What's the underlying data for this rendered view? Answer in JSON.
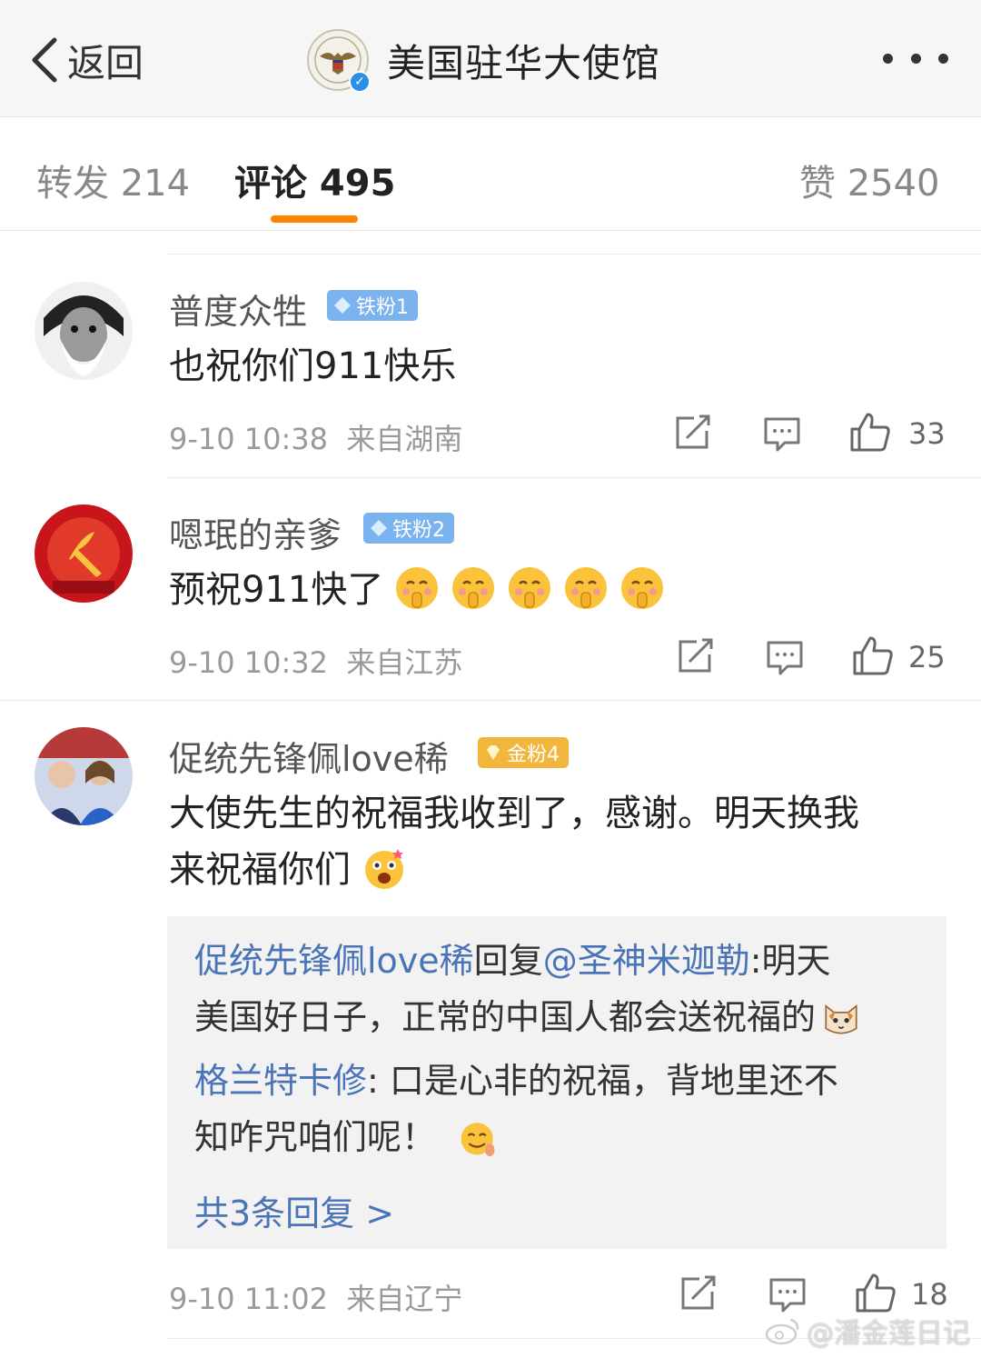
{
  "header": {
    "back_label": "返回",
    "title": "美国驻华大使馆",
    "verified_icon": "verified-badge-icon",
    "more_icon": "more-dots-icon"
  },
  "tabs": [
    {
      "label": "转发 214",
      "active": false
    },
    {
      "label": "评论 495",
      "active": true
    },
    {
      "label": "赞 2540",
      "active": false
    }
  ],
  "accent_color": "#ff8200",
  "link_color": "#4a74b8",
  "comments": [
    {
      "username": "普度众牲",
      "badge": "铁粉1",
      "text": "也祝你们911快乐",
      "time": "9-10 10:38",
      "location": "来自湖南",
      "likes": "33"
    },
    {
      "username": "嗯珉的亲爹",
      "badge": "铁粉2",
      "text": "预祝911快了",
      "time": "9-10 10:32",
      "location": "来自江苏",
      "likes": "25"
    },
    {
      "username": "促统先锋佩love稀",
      "badge": "金粉4",
      "text_line1": "大使先生的祝福我收到了，感谢。明天换我",
      "text_line2": "来祝福你们",
      "time": "9-10 11:02",
      "location": "来自辽宁",
      "likes": "18",
      "replies": [
        {
          "author": "促统先锋佩love稀",
          "reply_word": "回复",
          "mention": "@圣神米迦勒",
          "text_line1": ":明天",
          "text_line2": "美国好日子，正常的中国人都会送祝福的"
        },
        {
          "author": "格兰特卡修",
          "text_line1": ": 口是心非的祝福，背地里还不",
          "text_line2": "知咋咒咱们呢！"
        }
      ],
      "more_replies": "共3条回复 >"
    }
  ],
  "watermark": "@潘金莲日记"
}
